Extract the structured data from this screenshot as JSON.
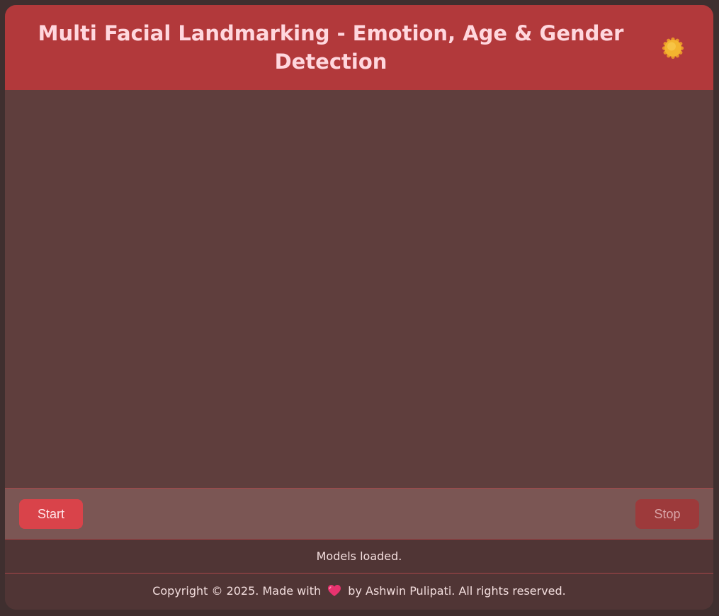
{
  "header": {
    "title": "Multi Facial Landmarking - Emotion, Age & Gender Detection",
    "theme_icon": "sun-icon"
  },
  "controls": {
    "start_label": "Start",
    "stop_label": "Stop"
  },
  "status": {
    "text": "Models loaded."
  },
  "footer": {
    "prefix": "Copyright © 2025. Made with",
    "heart_icon": "heart-icon",
    "suffix": "by Ashwin Pulipati. All rights reserved."
  },
  "colors": {
    "page_bg": "#3f2f2f",
    "header_bg": "#b2393b",
    "title_text": "#ffd7de",
    "video_bg": "#5f3e3d",
    "controls_bg": "#7b5654",
    "start_button": "#d9434a",
    "stop_button": "#9d3a3b",
    "status_bg": "#503535",
    "sun": "#f3b42f"
  }
}
